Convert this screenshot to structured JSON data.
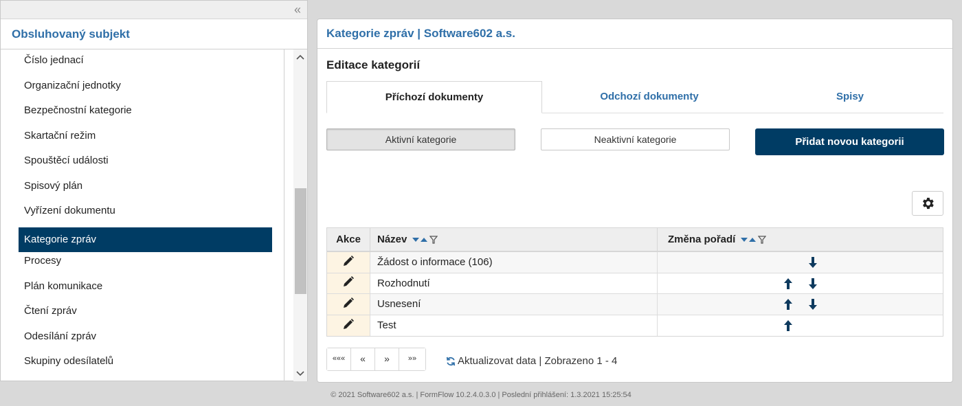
{
  "left": {
    "title": "Obsluhovaný subjekt",
    "items": [
      {
        "label": "Číslo jednací"
      },
      {
        "label": "Organizační jednotky"
      },
      {
        "label": "Bezpečnostní kategorie"
      },
      {
        "label": "Skartační režim"
      },
      {
        "label": "Spouštěcí události"
      },
      {
        "label": "Spisový plán"
      },
      {
        "label": "Vyřízení dokumentu"
      },
      {
        "label": "Kategorie zpráv"
      },
      {
        "label": "Procesy"
      },
      {
        "label": "Plán komunikace"
      },
      {
        "label": "Čtení zpráv"
      },
      {
        "label": "Odesílání zpráv"
      },
      {
        "label": "Skupiny odesílatelů"
      }
    ],
    "active_index": 7
  },
  "main": {
    "header": "Kategorie zpráv | Software602 a.s.",
    "section_title": "Editace kategorií",
    "tabs": [
      {
        "label": "Příchozí dokumenty",
        "active": true
      },
      {
        "label": "Odchozí dokumenty",
        "active": false
      },
      {
        "label": "Spisy",
        "active": false
      }
    ],
    "buttons": {
      "active_categories": "Aktivní kategorie",
      "inactive_categories": "Neaktivní kategorie",
      "add_category": "Přidat novou kategorii"
    },
    "table": {
      "headers": {
        "akce": "Akce",
        "nazev": "Název",
        "zmena": "Změna pořadí"
      },
      "rows": [
        {
          "name": "Žádost o informace (106)",
          "up": false,
          "down": true
        },
        {
          "name": "Rozhodnutí",
          "up": true,
          "down": true
        },
        {
          "name": "Usnesení",
          "up": true,
          "down": true
        },
        {
          "name": "Test",
          "up": true,
          "down": false
        }
      ]
    },
    "pager": {
      "first": "«««",
      "prev": "«",
      "next": "»",
      "last": "»»"
    },
    "refresh_text": "Aktualizovat data | Zobrazeno 1 - 4"
  },
  "footer": "© 2021 Software602 a.s. | FormFlow 10.2.4.0.3.0 | Poslední přihlášení: 1.3.2021 15:25:54",
  "colors": {
    "accent": "#003c64",
    "link": "#2f6fa8",
    "edit_cell": "#fdf4e3"
  }
}
